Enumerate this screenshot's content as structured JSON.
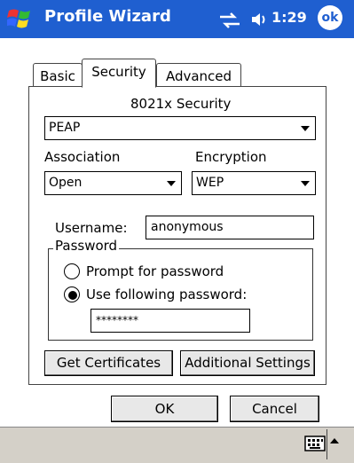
{
  "window": {
    "title": "Profile Wizard",
    "clock": "1:29",
    "ok_label": "ok"
  },
  "tabs": [
    {
      "label": "Basic",
      "active": false
    },
    {
      "label": "Security",
      "active": true
    },
    {
      "label": "Advanced",
      "active": false
    }
  ],
  "security": {
    "heading": "8021x Security",
    "eap_value": "PEAP",
    "association_label": "Association",
    "association_value": "Open",
    "encryption_label": "Encryption",
    "encryption_value": "WEP",
    "username_label": "Username:",
    "username_value": "anonymous",
    "password_group": "Password",
    "radio_prompt": "Prompt for password",
    "radio_use": "Use following password:",
    "selected_radio": "use",
    "password_value": "********"
  },
  "buttons": {
    "get_certificates": "Get Certificates",
    "additional_settings": "Additional Settings",
    "ok": "OK",
    "cancel": "Cancel"
  },
  "icons": {
    "start": "windows-flag-icon",
    "connectivity": "connectivity-icon",
    "volume": "volume-icon",
    "keyboard": "keyboard-icon",
    "sip": "chevron-up-icon"
  },
  "colors": {
    "titlebar": "#1f5fd0",
    "menubar": "#d4d0c8"
  }
}
